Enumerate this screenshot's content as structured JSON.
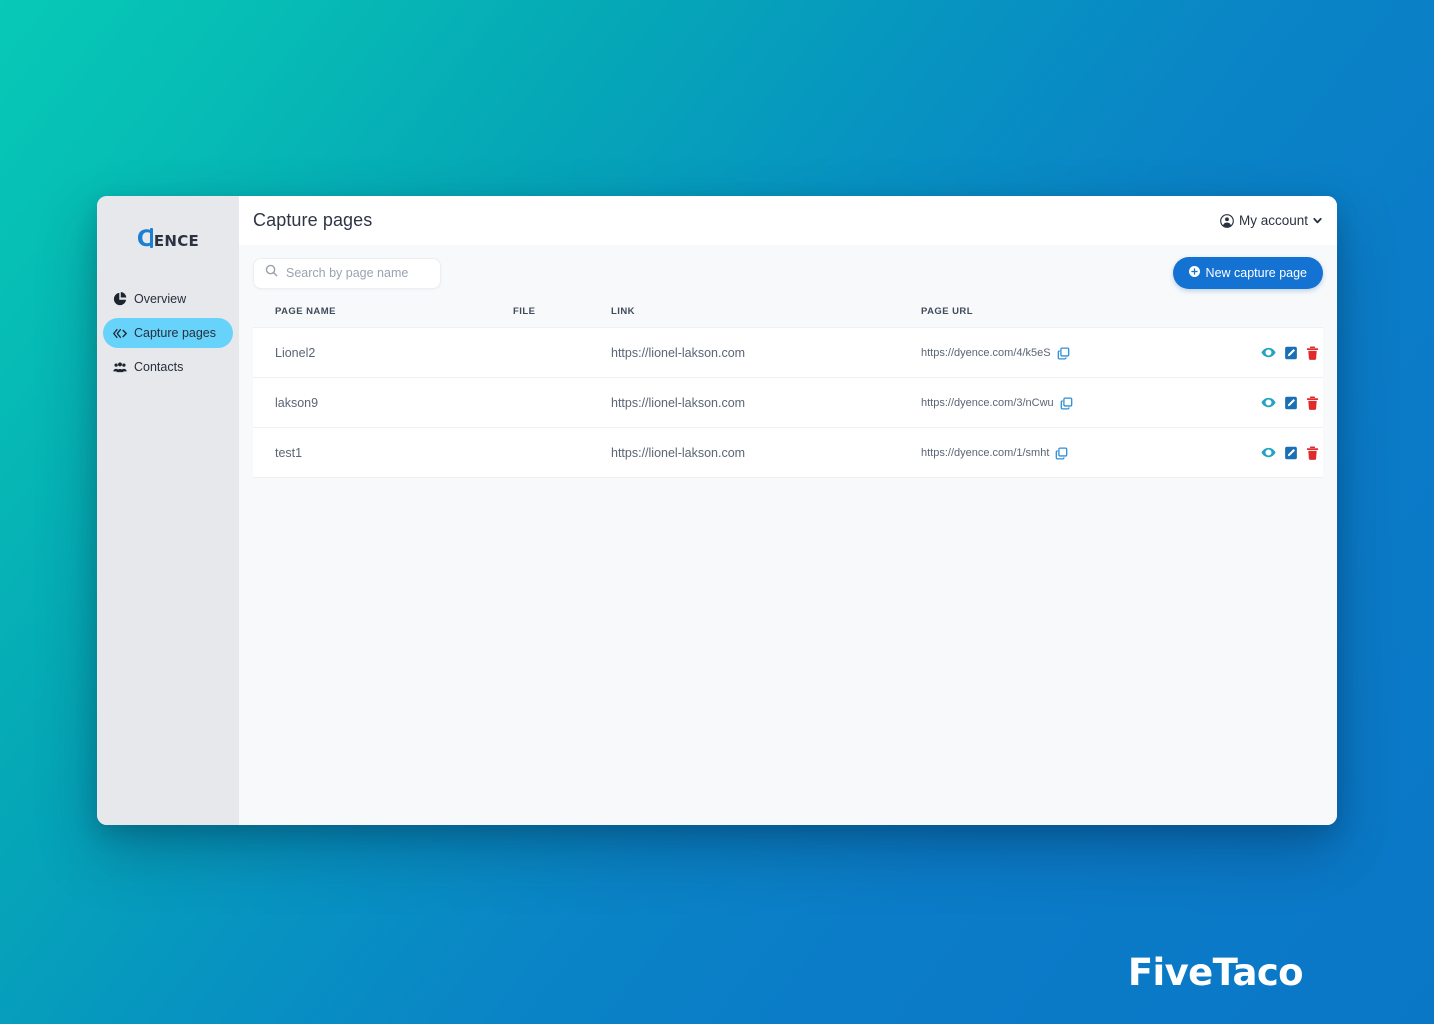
{
  "brand": {
    "logo_prefix": "C",
    "logo_rest": "ENCE",
    "full_name": "CIENCE"
  },
  "sidebar": {
    "items": [
      {
        "label": "Overview",
        "icon": "pie-chart-icon",
        "active": false
      },
      {
        "label": "Capture pages",
        "icon": "code-icon",
        "active": true
      },
      {
        "label": "Contacts",
        "icon": "users-group-icon",
        "active": false
      }
    ]
  },
  "header": {
    "title": "Capture pages",
    "account_label": "My account",
    "account_icon": "user-circle-icon",
    "caret_icon": "chevron-down-icon"
  },
  "toolbar": {
    "search_placeholder": "Search by page name",
    "search_value": "",
    "search_icon": "search-icon",
    "new_button_label": "New capture page",
    "new_button_icon": "plus-circle-icon"
  },
  "table": {
    "columns": [
      "PAGE NAME",
      "FILE",
      "LINK",
      "PAGE URL",
      ""
    ],
    "rows": [
      {
        "page_name": "Lionel2",
        "file": "",
        "link": "https://lionel-lakson.com",
        "page_url": "https://dyence.com/4/k5eS",
        "actions": [
          "view-icon",
          "edit-icon",
          "delete-icon"
        ]
      },
      {
        "page_name": "lakson9",
        "file": "",
        "link": "https://lionel-lakson.com",
        "page_url": "https://dyence.com/3/nCwu",
        "actions": [
          "view-icon",
          "edit-icon",
          "delete-icon"
        ]
      },
      {
        "page_name": "test1",
        "file": "",
        "link": "https://lionel-lakson.com",
        "page_url": "https://dyence.com/1/smht",
        "actions": [
          "view-icon",
          "edit-icon",
          "delete-icon"
        ]
      }
    ],
    "copy_icon": "copy-icon"
  },
  "watermark": {
    "text": "FiveTaco"
  },
  "colors": {
    "accent_blue": "#1472d3",
    "active_nav": "#67d3fb",
    "background_start": "#07c9b7",
    "background_end": "#0b7cc8",
    "view_icon": "#27a3c2",
    "edit_icon": "#1a6fb5",
    "delete_icon": "#e02b2b",
    "copy_icon": "#2d8fd6"
  }
}
